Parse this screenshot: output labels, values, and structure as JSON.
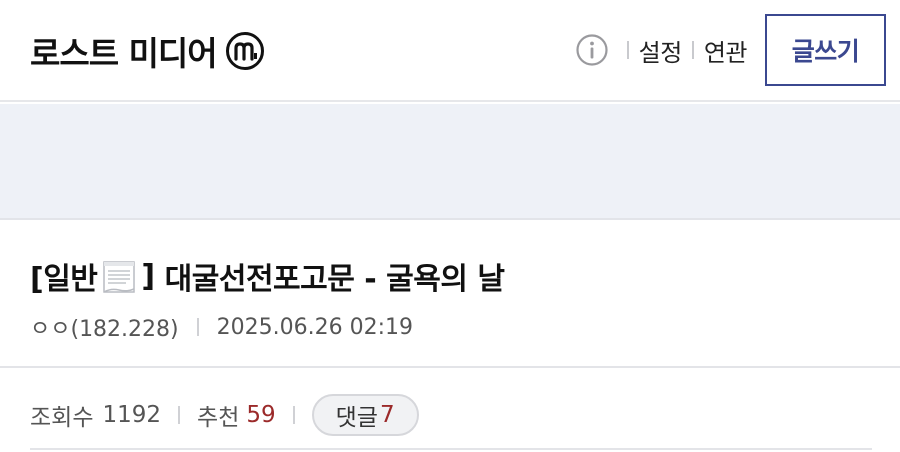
{
  "header": {
    "site_title": "로스트 미디어",
    "settings_label": "설정",
    "related_label": "연관",
    "write_label": "글쓰기"
  },
  "icons": {
    "site_logo": "circled-m-icon",
    "info": "info-icon",
    "category_icon": "document-icon"
  },
  "post": {
    "category_open": "[일반",
    "category_close": "]",
    "title": "대굴선전포고문 - 굴욕의 날",
    "author": "ㅇㅇ(182.228)",
    "datetime": "2025.06.26 02:19"
  },
  "stats": {
    "views_label": "조회수",
    "views": "1192",
    "recommend_label": "추천",
    "recommend": "59",
    "comments_label": "댓글",
    "comments": "7"
  },
  "colors": {
    "accent": "#3b4890",
    "count_red": "#9b2a2a",
    "banner_bg": "#eef1f7"
  }
}
